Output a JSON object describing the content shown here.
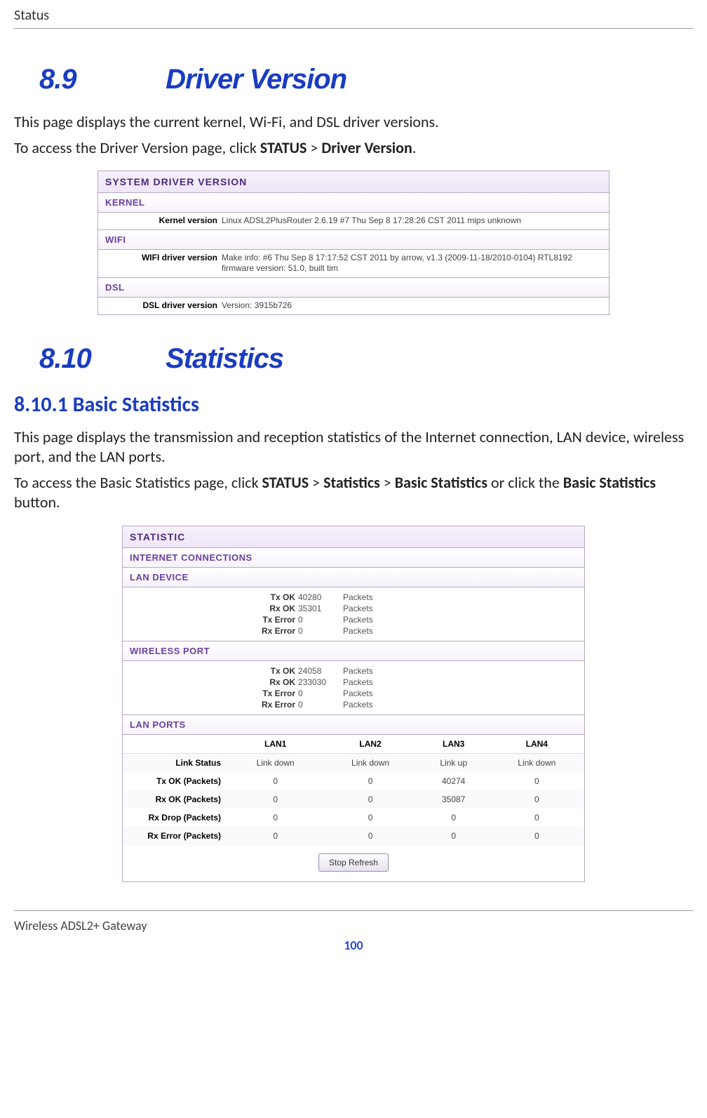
{
  "page": {
    "header": "Status",
    "footer_text": "Wireless ADSL2+ Gateway",
    "page_number": "100"
  },
  "sec89": {
    "num": "8.9",
    "title": "Driver Version",
    "p1": "This page displays the current kernel, Wi-Fi, and DSL driver versions.",
    "p2a": "To access the Driver Version page, click ",
    "p2b": "STATUS",
    "p2c": " > ",
    "p2d": "Driver Version",
    "p2e": "."
  },
  "driver_panel": {
    "title": "SYSTEM DRIVER VERSION",
    "kernel_hdr": "KERNEL",
    "kernel_label": "Kernel version",
    "kernel_value": "Linux ADSL2PlusRouter 2.6.19 #7 Thu Sep 8 17:28:26 CST 2011 mips unknown",
    "wifi_hdr": "WIFI",
    "wifi_label": "WIFI driver version",
    "wifi_value": "Make info: #6 Thu Sep 8 17:17:52 CST 2011 by arrow, v1.3 (2009-11-18/2010-0104) RTL8192 firmware version: 51.0, built tim",
    "dsl_hdr": "DSL",
    "dsl_label": "DSL driver version",
    "dsl_value": "Version: 3915b726"
  },
  "sec810": {
    "num": "8.10",
    "title": "Statistics"
  },
  "sec8101": {
    "heading": "8.10.1  Basic Statistics",
    "p1": "This page displays the transmission and reception statistics of the Internet connection, LAN device, wireless port, and the LAN ports.",
    "p2_pre": "To access the Basic Statistics page, click ",
    "p2_b1": "STATUS",
    "p2_gt1": " > ",
    "p2_b2": "Statistics",
    "p2_gt2": " > ",
    "p2_b3": "Basic Statistics",
    "p2_mid": " or click the ",
    "p2_b4": "Basic Statistics",
    "p2_end": " button."
  },
  "stat_panel": {
    "title": "STATISTIC",
    "internet_hdr": "INTERNET CONNECTIONS",
    "lan_device_hdr": "LAN DEVICE",
    "lan_device": {
      "txok_l": "Tx OK",
      "txok_v": "40280",
      "txok_u": "Packets",
      "rxok_l": "Rx OK",
      "rxok_v": "35301",
      "rxok_u": "Packets",
      "txerr_l": "Tx Error",
      "txerr_v": "0",
      "txerr_u": "Packets",
      "rxerr_l": "Rx Error",
      "rxerr_v": "0",
      "rxerr_u": "Packets"
    },
    "wireless_hdr": "WIRELESS PORT",
    "wireless": {
      "txok_l": "Tx OK",
      "txok_v": "24058",
      "txok_u": "Packets",
      "rxok_l": "Rx OK",
      "rxok_v": "233030",
      "rxok_u": "Packets",
      "txerr_l": "Tx Error",
      "txerr_v": "0",
      "txerr_u": "Packets",
      "rxerr_l": "Rx Error",
      "rxerr_v": "0",
      "rxerr_u": "Packets"
    },
    "lanports_hdr": "LAN PORTS",
    "cols": {
      "c1": "LAN1",
      "c2": "LAN2",
      "c3": "LAN3",
      "c4": "LAN4"
    },
    "rows": {
      "link": {
        "label": "Link Status",
        "v1": "Link down",
        "v2": "Link down",
        "v3": "Link up",
        "v4": "Link down"
      },
      "txok": {
        "label": "Tx OK (Packets)",
        "v1": "0",
        "v2": "0",
        "v3": "40274",
        "v4": "0"
      },
      "rxok": {
        "label": "Rx OK (Packets)",
        "v1": "0",
        "v2": "0",
        "v3": "35087",
        "v4": "0"
      },
      "rxdrop": {
        "label": "Rx Drop (Packets)",
        "v1": "0",
        "v2": "0",
        "v3": "0",
        "v4": "0"
      },
      "rxerr": {
        "label": "Rx Error (Packets)",
        "v1": "0",
        "v2": "0",
        "v3": "0",
        "v4": "0"
      }
    },
    "button": "Stop Refresh"
  }
}
